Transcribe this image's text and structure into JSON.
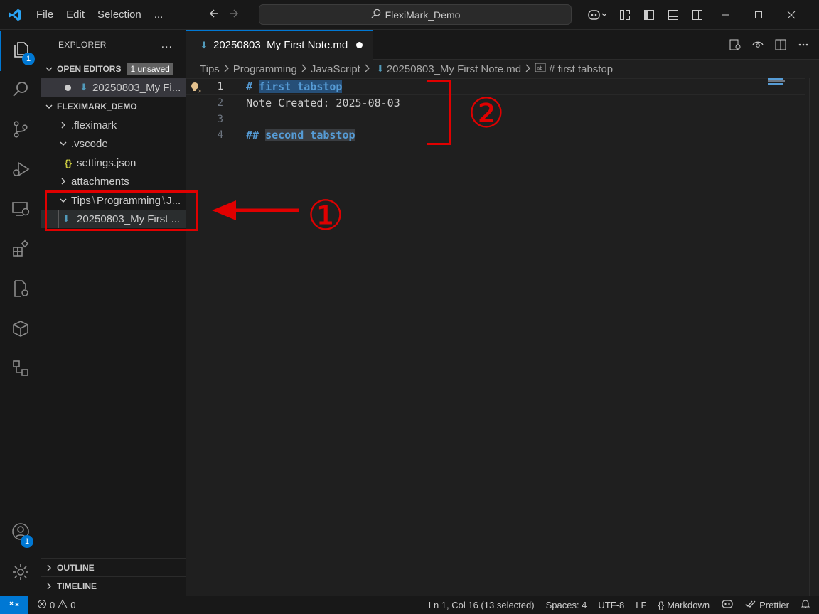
{
  "menu": {
    "file": "File",
    "edit": "Edit",
    "selection": "Selection",
    "more": "..."
  },
  "search": {
    "text": "FlexiMark_Demo"
  },
  "activity": {
    "explorer_badge": "1",
    "accounts_badge": "1"
  },
  "sidebar": {
    "title": "EXPLORER",
    "more": "...",
    "open_editors": {
      "label": "OPEN EDITORS",
      "badge": "1 unsaved",
      "file": "20250803_My Fi..."
    },
    "project": {
      "label": "FLEXIMARK_DEMO"
    },
    "tree": {
      "fleximark": ".fleximark",
      "vscode": ".vscode",
      "settings": "settings.json",
      "attachments": "attachments",
      "folder_a": "Tips",
      "folder_b": "Programming",
      "folder_c": "J...",
      "note": "20250803_My First ..."
    },
    "outline": "OUTLINE",
    "timeline": "TIMELINE"
  },
  "tab": {
    "title": "20250803_My First Note.md"
  },
  "breadcrumb": {
    "b1": "Tips",
    "b2": "Programming",
    "b3": "JavaScript",
    "b4": "20250803_My First Note.md",
    "b5": "# first tabstop"
  },
  "editor": {
    "lines": [
      {
        "num": "1",
        "hash": "#",
        "text": "first tabstop"
      },
      {
        "num": "2",
        "text": "Note Created: 2025-08-03"
      },
      {
        "num": "3",
        "text": ""
      },
      {
        "num": "4",
        "hash": "##",
        "text": "second tabstop"
      }
    ]
  },
  "annotations": {
    "one": "①",
    "two": "②"
  },
  "status": {
    "errors": "0",
    "warnings": "0",
    "position": "Ln 1, Col 16 (13 selected)",
    "spaces": "Spaces: 4",
    "encoding": "UTF-8",
    "eol": "LF",
    "language": "Markdown",
    "prettier": "Prettier"
  },
  "colors": {
    "accent": "#0078d4",
    "annotation": "#e00000",
    "heading": "#569cd6"
  }
}
